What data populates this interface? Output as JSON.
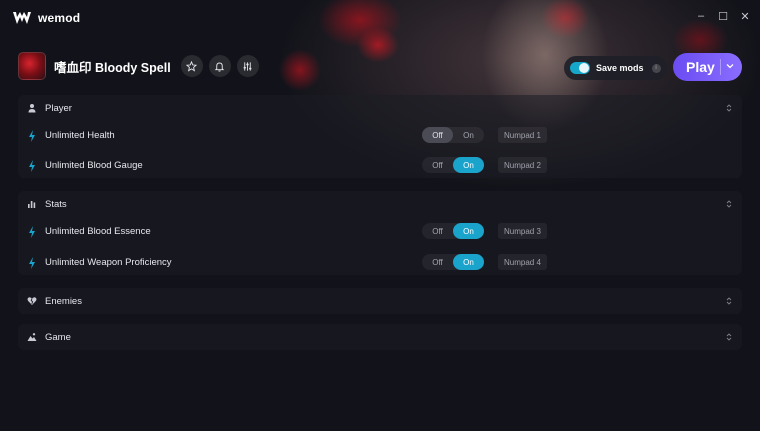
{
  "app": {
    "name": "wemod"
  },
  "window_controls": [
    "–",
    "☐",
    "✕"
  ],
  "game": {
    "title": "嗜血印 Bloody Spell"
  },
  "header_buttons": [
    "star-icon",
    "bell-icon",
    "sliders-icon"
  ],
  "save_mods": {
    "label": "Save mods",
    "enabled": true,
    "info": "i"
  },
  "play": {
    "label": "Play"
  },
  "colors": {
    "accent_toggle": "#1aa3cb",
    "play_button": "#7a5cf8"
  },
  "sections": [
    {
      "title": "Player",
      "icon": "user-icon",
      "mods": [
        {
          "label": "Unlimited Health",
          "off": "Off",
          "on": "On",
          "state": "off",
          "hotkey": "Numpad 1"
        },
        {
          "label": "Unlimited Blood Gauge",
          "off": "Off",
          "on": "On",
          "state": "on",
          "hotkey": "Numpad 2"
        }
      ]
    },
    {
      "title": "Stats",
      "icon": "bar-chart-icon",
      "mods": [
        {
          "label": "Unlimited Blood Essence",
          "off": "Off",
          "on": "On",
          "state": "on",
          "hotkey": "Numpad 3"
        },
        {
          "label": "Unlimited Weapon Proficiency",
          "off": "Off",
          "on": "On",
          "state": "on",
          "hotkey": "Numpad 4"
        }
      ]
    },
    {
      "title": "Enemies",
      "icon": "broken-heart-icon",
      "mods": []
    },
    {
      "title": "Game",
      "icon": "landscape-icon",
      "mods": []
    }
  ]
}
